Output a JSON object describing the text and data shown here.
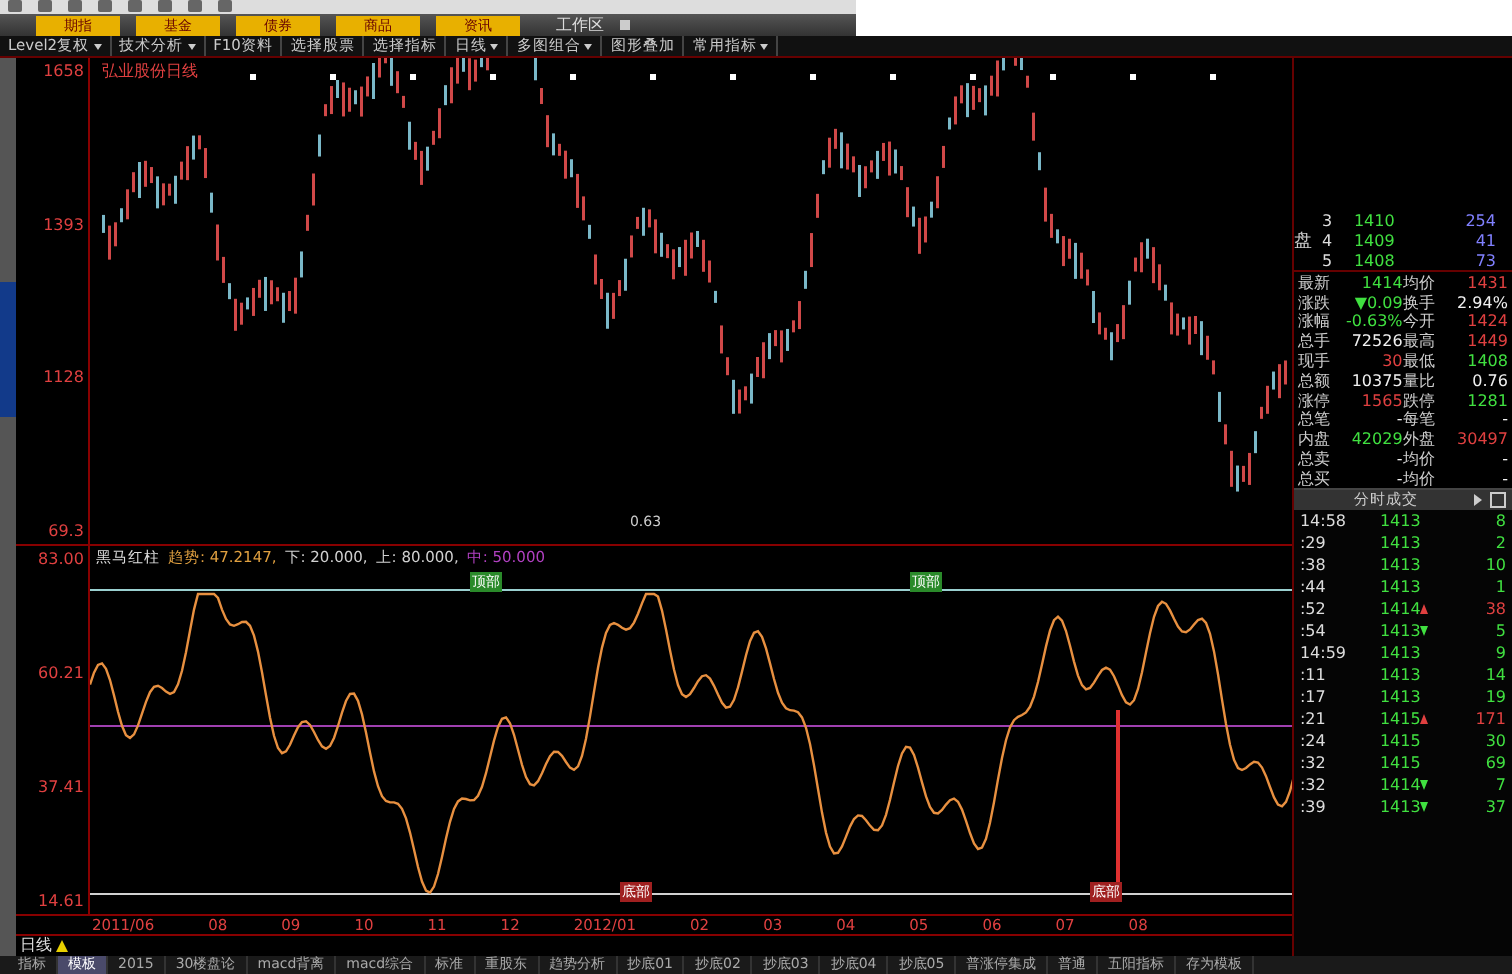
{
  "nav_buttons": [
    {
      "label": "期指"
    },
    {
      "label": "基金"
    },
    {
      "label": "债券"
    },
    {
      "label": "商品"
    },
    {
      "label": "资讯"
    }
  ],
  "workspace": {
    "label": "工作区"
  },
  "menu": [
    {
      "label": "Level2复权",
      "dropdown": true
    },
    {
      "label": "技术分析",
      "dropdown": true
    },
    {
      "label": "F10资料",
      "dropdown": false
    },
    {
      "label": "选择股票",
      "dropdown": false
    },
    {
      "label": "选择指标",
      "dropdown": false
    },
    {
      "label": "日线",
      "dropdown": true
    },
    {
      "label": "多图组合",
      "dropdown": true
    },
    {
      "label": "图形叠加",
      "dropdown": false
    },
    {
      "label": "常用指标",
      "dropdown": true
    }
  ],
  "price_chart": {
    "title": "弘业股份日线",
    "axis_labels": [
      "1658",
      "1393",
      "1128"
    ],
    "low_label": "0.63",
    "bottom_label": "69.3"
  },
  "indicator": {
    "name": "黑马红柱",
    "series": [
      {
        "label": "趋势:",
        "value": "47.2147,",
        "color": "#e0a040"
      },
      {
        "label": "下:",
        "value": "20.000,",
        "color": "#d0d0d0"
      },
      {
        "label": "上:",
        "value": "80.000,",
        "color": "#d0d0d0"
      },
      {
        "label": "中:",
        "value": "50.000",
        "color": "#b040c0"
      }
    ],
    "axis_labels": [
      "83.00",
      "60.21",
      "37.41",
      "14.61"
    ],
    "top_marks": [
      "顶部",
      "顶部"
    ],
    "bottom_marks": [
      "底部",
      "底部"
    ]
  },
  "dates": [
    "2011/06",
    "08",
    "09",
    "10",
    "11",
    "12",
    "2012/01",
    "02",
    "03",
    "04",
    "05",
    "06",
    "07",
    "08"
  ],
  "period": {
    "label": "日线"
  },
  "tabs": [
    {
      "label": "指标",
      "selected": false
    },
    {
      "label": "模板",
      "selected": true
    },
    {
      "label": "2015",
      "selected": false
    },
    {
      "label": "30楼盘论",
      "selected": false
    },
    {
      "label": "macd背离",
      "selected": false
    },
    {
      "label": "macd综合",
      "selected": false
    },
    {
      "label": "标准",
      "selected": false
    },
    {
      "label": "重股东",
      "selected": false
    },
    {
      "label": "趋势分析",
      "selected": false
    },
    {
      "label": "抄底01",
      "selected": false
    },
    {
      "label": "抄底02",
      "selected": false
    },
    {
      "label": "抄底03",
      "selected": false
    },
    {
      "label": "抄底04",
      "selected": false
    },
    {
      "label": "抄底05",
      "selected": false
    },
    {
      "label": "普涨停集成",
      "selected": false
    },
    {
      "label": "普通",
      "selected": false
    },
    {
      "label": "五阳指标",
      "selected": false
    },
    {
      "label": "存为模板",
      "selected": false
    }
  ],
  "order_book": {
    "side_label": "盘",
    "rows": [
      {
        "level": "3",
        "price": "1410",
        "volume": "254"
      },
      {
        "level": "4",
        "price": "1409",
        "volume": "41"
      },
      {
        "level": "5",
        "price": "1408",
        "volume": "73"
      }
    ]
  },
  "quote": [
    {
      "label": "最新",
      "value": "1414",
      "label2": "均价",
      "value2": "1431",
      "up": false,
      "down": true,
      "up2": true,
      "down2": false
    },
    {
      "label": "涨跌",
      "value": "▼0.09",
      "label2": "换手",
      "value2": "2.94%",
      "up": false,
      "down": true,
      "up2": false,
      "down2": false
    },
    {
      "label": "涨幅",
      "value": "-0.63%",
      "label2": "今开",
      "value2": "1424",
      "up": false,
      "down": true,
      "up2": true,
      "down2": false
    },
    {
      "label": "总手",
      "value": "72526",
      "label2": "最高",
      "value2": "1449",
      "up": false,
      "down": false,
      "up2": true,
      "down2": false
    },
    {
      "label": "现手",
      "value": "30",
      "label2": "最低",
      "value2": "1408",
      "up": true,
      "down": false,
      "up2": false,
      "down2": true
    },
    {
      "label": "总额",
      "value": "10375",
      "label2": "量比",
      "value2": "0.76",
      "up": false,
      "down": false,
      "up2": false,
      "down2": false
    },
    {
      "label": "涨停",
      "value": "1565",
      "label2": "跌停",
      "value2": "1281",
      "up": true,
      "down": false,
      "up2": false,
      "down2": true
    },
    {
      "label": "总笔",
      "value": "-",
      "label2": "每笔",
      "value2": "-",
      "up": false,
      "down": false,
      "up2": false,
      "down2": false
    },
    {
      "label": "内盘",
      "value": "42029",
      "label2": "外盘",
      "value2": "30497",
      "up": false,
      "down": true,
      "up2": true,
      "down2": false
    },
    {
      "label": "总卖",
      "value": "-",
      "label2": "均价",
      "value2": "-",
      "up": false,
      "down": false,
      "up2": false,
      "down2": false
    },
    {
      "label": "总买",
      "value": "-",
      "label2": "均价",
      "value2": "-",
      "up": false,
      "down": false,
      "up2": false,
      "down2": false
    }
  ],
  "trades": {
    "title": "分时成交",
    "rows": [
      {
        "time": "14:58",
        "price": "1413",
        "volume": "8",
        "up": false,
        "down": false
      },
      {
        "time": ":29",
        "price": "1413",
        "volume": "2",
        "up": false,
        "down": false
      },
      {
        "time": ":38",
        "price": "1413",
        "volume": "10",
        "up": false,
        "down": false
      },
      {
        "time": ":44",
        "price": "1413",
        "volume": "1",
        "up": false,
        "down": false
      },
      {
        "time": ":52",
        "price": "1414",
        "volume": "38",
        "up": true,
        "down": false
      },
      {
        "time": ":54",
        "price": "1413",
        "volume": "5",
        "up": false,
        "down": true
      },
      {
        "time": "14:59",
        "price": "1413",
        "volume": "9",
        "up": false,
        "down": false
      },
      {
        "time": ":11",
        "price": "1413",
        "volume": "14",
        "up": false,
        "down": false
      },
      {
        "time": ":17",
        "price": "1413",
        "volume": "19",
        "up": false,
        "down": false
      },
      {
        "time": ":21",
        "price": "1415",
        "volume": "171",
        "up": true,
        "down": false
      },
      {
        "time": ":24",
        "price": "1415",
        "volume": "30",
        "up": false,
        "down": false
      },
      {
        "time": ":32",
        "price": "1415",
        "volume": "69",
        "up": false,
        "down": false
      },
      {
        "time": ":32",
        "price": "1414",
        "volume": "7",
        "up": false,
        "down": true
      },
      {
        "time": ":39",
        "price": "1413",
        "volume": "37",
        "up": false,
        "down": true
      }
    ]
  }
}
